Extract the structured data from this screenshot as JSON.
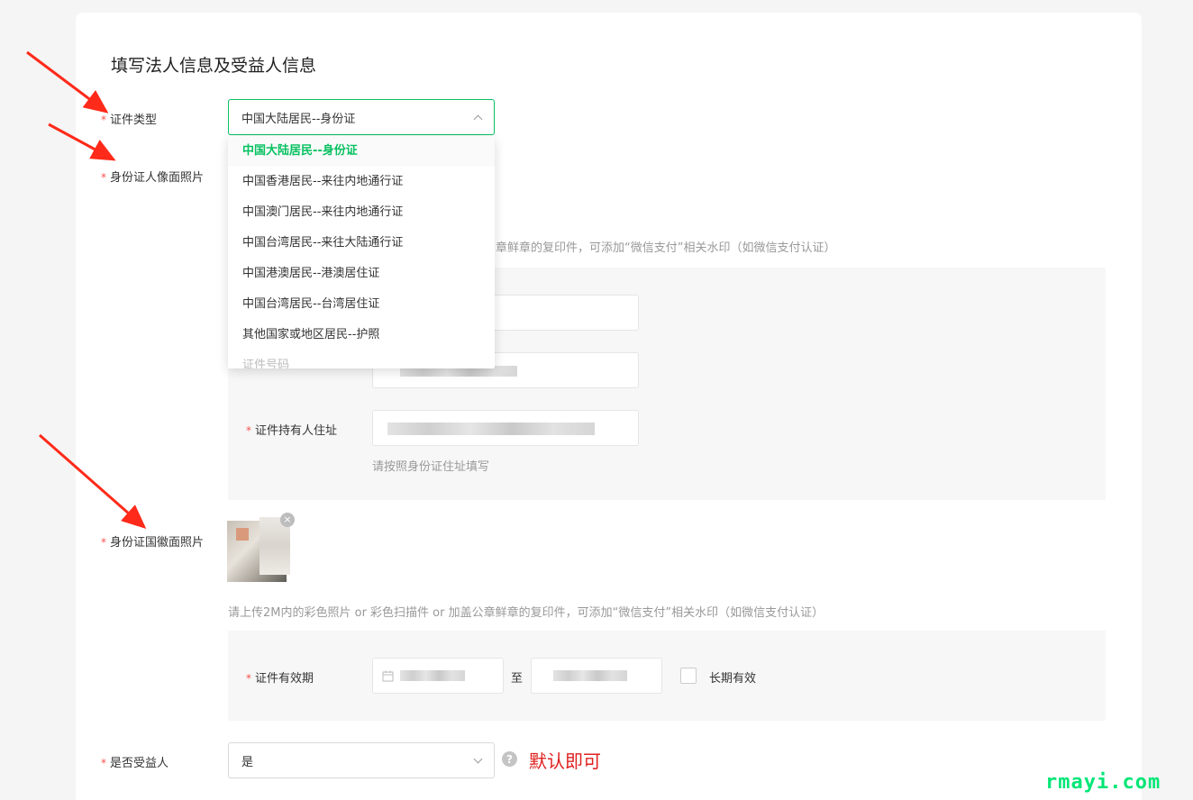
{
  "section_title": "填写法人信息及受益人信息",
  "id_type": {
    "label": "证件类型",
    "value": "中国大陆居民--身份证",
    "options": [
      "中国大陆居民--身份证",
      "中国香港居民--来往内地通行证",
      "中国澳门居民--来往内地通行证",
      "中国台湾居民--来往大陆通行证",
      "中国港澳居民--港澳居住证",
      "中国台湾居民--台湾居住证",
      "其他国家或地区居民--护照",
      "证件号码"
    ]
  },
  "front_photo": {
    "label": "身份证人像面照片",
    "hint_tail": "章鲜章的复印件，可添加“微信支付”相关水印（如微信支付认证）"
  },
  "holder_address": {
    "label": "证件持有人住址",
    "hint": "请按照身份证住址填写"
  },
  "back_photo": {
    "label": "身份证国徽面照片",
    "hint": "请上传2M内的彩色照片 or 彩色扫描件 or 加盖公章鲜章的复印件，可添加“微信支付”相关水印（如微信支付认证）"
  },
  "validity": {
    "label": "证件有效期",
    "separator": "至",
    "long_term_label": "长期有效"
  },
  "beneficiary": {
    "label": "是否受益人",
    "value": "是",
    "help_glyph": "?",
    "annotation": "默认即可"
  },
  "required_mark": "*",
  "watermark": "rmayi.com",
  "colors": {
    "accent": "#07c160",
    "required": "#fa5151",
    "annotation": "#e02020",
    "arrow": "#ff2a1a"
  }
}
